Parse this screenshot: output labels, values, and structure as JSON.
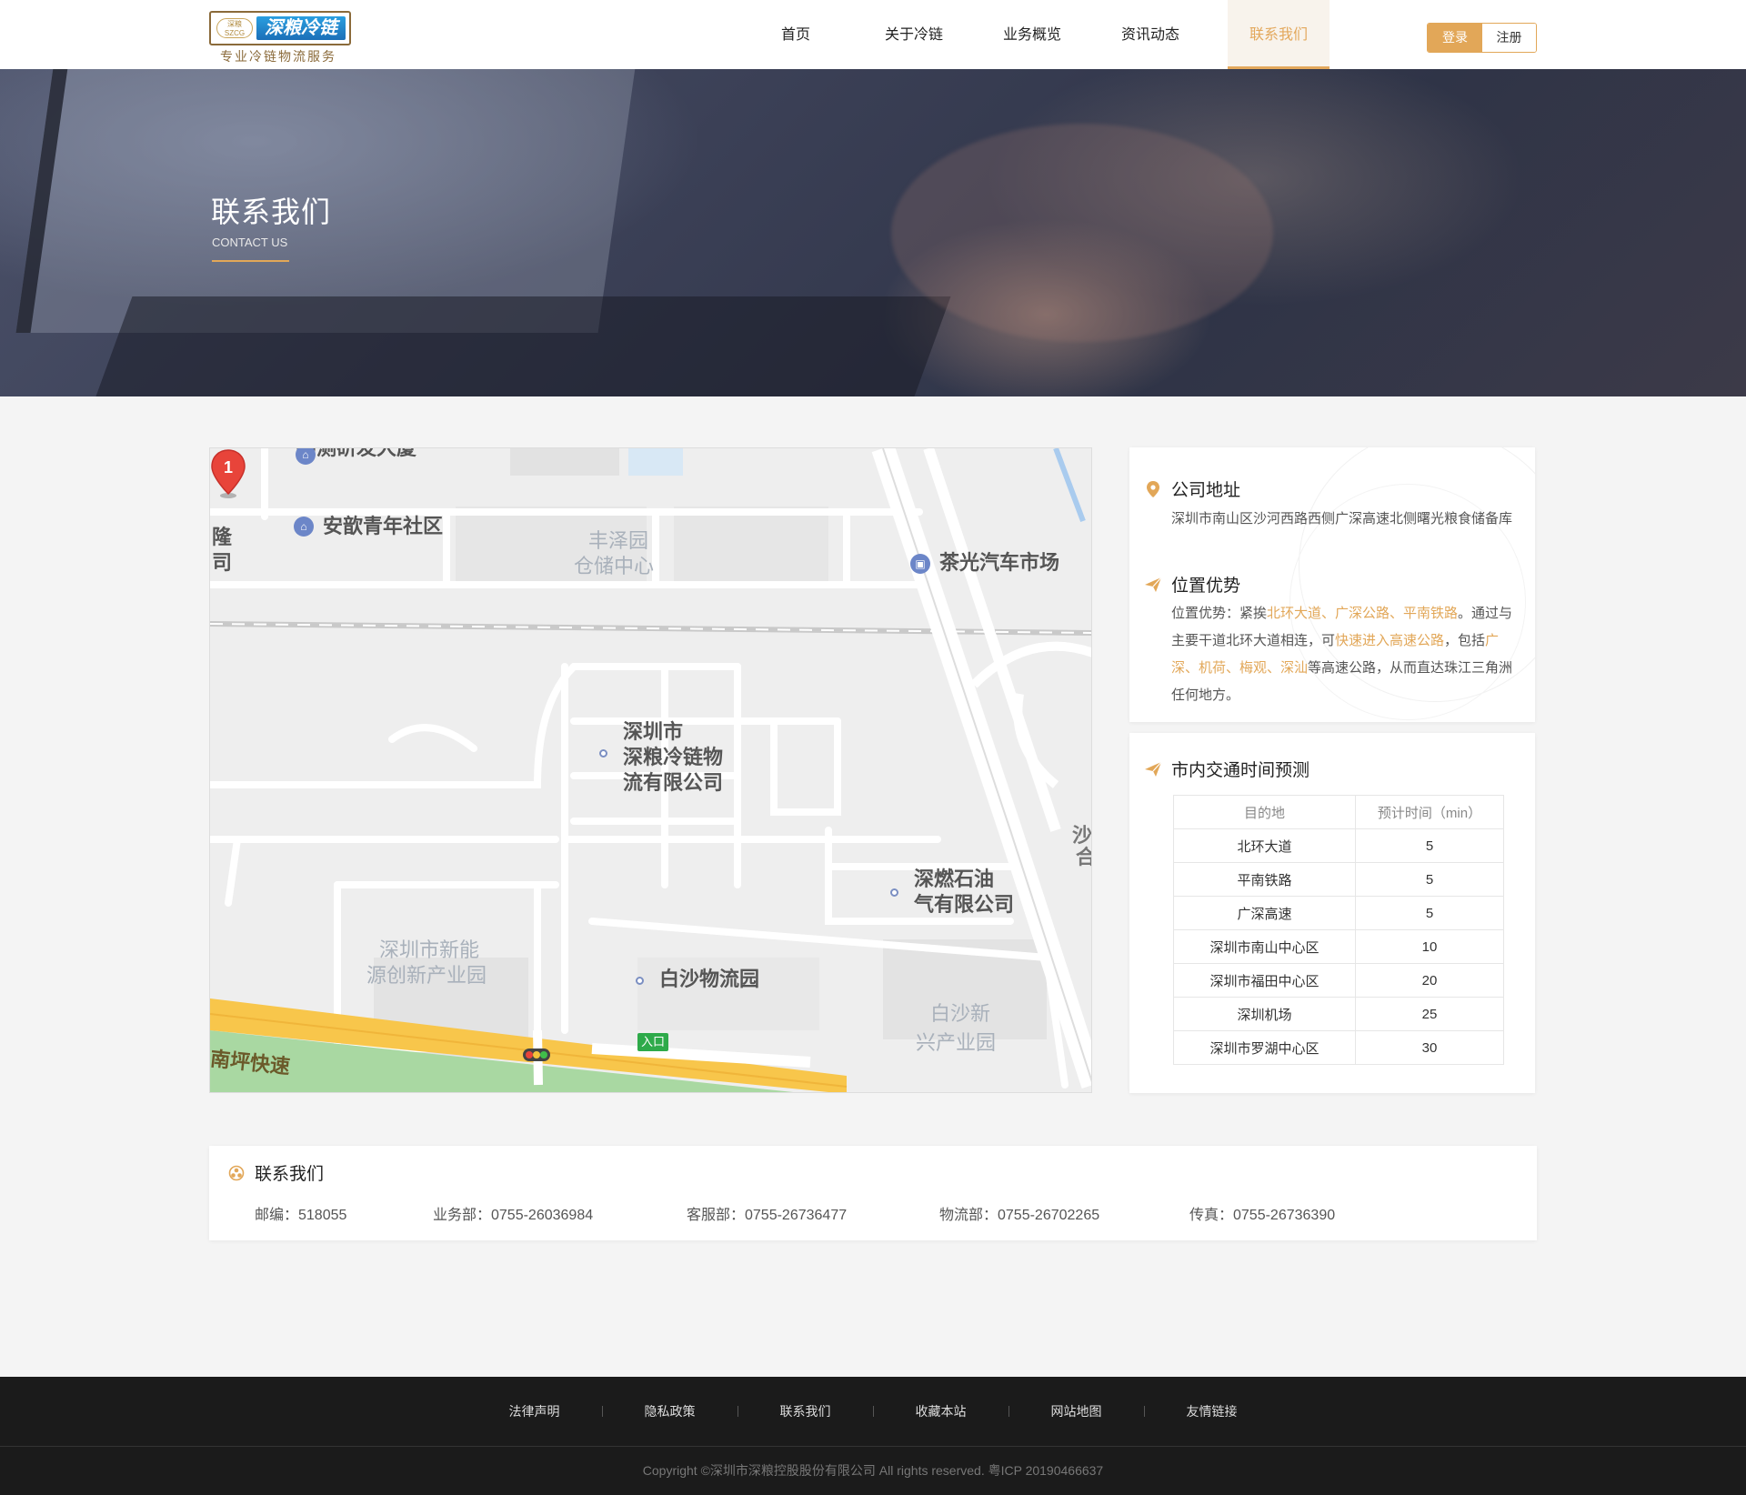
{
  "header": {
    "logo": {
      "badge": "深粮 SZCG",
      "name": "深粮冷链",
      "slogan": "专业冷链物流服务"
    },
    "nav": [
      "首页",
      "关于冷链",
      "业务概览",
      "资讯动态",
      "联系我们"
    ],
    "login_label": "登录",
    "register_label": "注册"
  },
  "banner": {
    "title": "联系我们",
    "subtitle": "CONTACT US"
  },
  "map": {
    "marker_number": "1",
    "labels": {
      "top_cut": "勘测研发大厦",
      "anxin": "安歆青年社区",
      "left_cut_1": "隆",
      "left_cut_2": "司",
      "fengze_1": "丰泽园",
      "fengze_2": "仓储中心",
      "chaguang": "茶光汽车市场",
      "company_1": "深圳市",
      "company_2": "深粮冷链物",
      "company_3": "流有限公司",
      "shenran_1": "深燃石油",
      "shenran_2": "气有限公司",
      "xinneng_1": "深圳市新能",
      "xinneng_2": "源创新产业园",
      "baisha_park": "白沙物流园",
      "baisha_new_1": "白沙新",
      "baisha_new_2": "兴产业园",
      "road": "南坪快速",
      "entrance": "入口",
      "right_cut_1": "沙",
      "right_cut_2": "合"
    }
  },
  "info": {
    "address": {
      "title": "公司地址",
      "text": "深圳市南山区沙河西路西侧广深高速北侧曙光粮食储备库"
    },
    "advantage": {
      "title": "位置优势",
      "p1": "位置优势：紧挨",
      "h1": "北环大道、广深公路、平南铁路",
      "p2": "。通过与主要干道北环大道相连，可",
      "h2": "快速进入高速公路",
      "p3": "，包括",
      "h3": "广深、机荷、梅观、深汕",
      "p4": "等高速公路，从而直达珠江三角洲任何地方。"
    },
    "traffic": {
      "title": "市内交通时间预测",
      "headers": [
        "目的地",
        "预计时间（min）"
      ],
      "rows": [
        [
          "北环大道",
          "5"
        ],
        [
          "平南铁路",
          "5"
        ],
        [
          "广深高速",
          "5"
        ],
        [
          "深圳市南山中心区",
          "10"
        ],
        [
          "深圳市福田中心区",
          "20"
        ],
        [
          "深圳机场",
          "25"
        ],
        [
          "深圳市罗湖中心区",
          "30"
        ]
      ]
    }
  },
  "contact": {
    "title": "联系我们",
    "items": [
      "邮编：518055",
      "业务部：0755-26036984",
      "客服部：0755-26736477",
      "物流部：0755-26702265",
      "传真：0755-26736390"
    ]
  },
  "footer": {
    "links": [
      "法律声明",
      "隐私政策",
      "联系我们",
      "收藏本站",
      "网站地图",
      "友情链接"
    ],
    "copyright": "Copyright ©深圳市深粮控股股份有限公司 All rights reserved. 粤ICP 20190466637"
  },
  "colors": {
    "accent": "#e2a758",
    "footer_bg": "#1b1b1b",
    "page_bg": "#f4f4f4"
  }
}
